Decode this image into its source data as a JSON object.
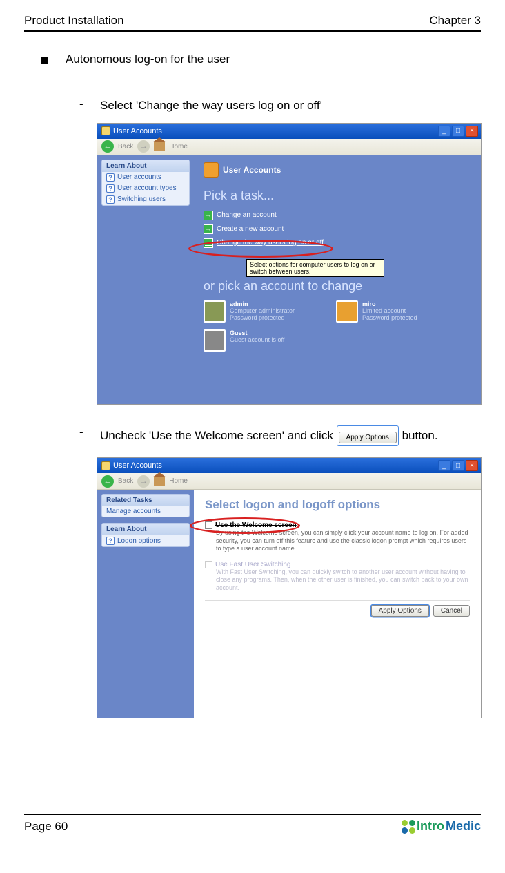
{
  "header": {
    "left": "Product Installation",
    "right": "Chapter 3"
  },
  "bullet1": "Autonomous log-on for the user",
  "step1": "Select 'Change the way users log on or off'",
  "step2_a": "Uncheck 'Use the Welcome screen' and click",
  "step2_b": "button.",
  "apply_btn_inline": "Apply Options",
  "win": {
    "title": "User Accounts",
    "back": "Back",
    "home": "Home",
    "min": "_",
    "max": "□",
    "close": "×"
  },
  "shot1": {
    "learn_head": "Learn About",
    "learn": [
      "User accounts",
      "User account types",
      "Switching users"
    ],
    "ua_title": "User Accounts",
    "pick": "Pick a task...",
    "tasks": [
      "Change an account",
      "Create a new account",
      "Change the way users log on or off"
    ],
    "tooltip": "Select options for computer users to log on or switch between users.",
    "orpick": "or pick an account to change",
    "accts": [
      {
        "name": "admin",
        "role": "Computer administrator",
        "pw": "Password protected"
      },
      {
        "name": "miro",
        "role": "Limited account",
        "pw": "Password protected"
      },
      {
        "name": "Guest",
        "role": "Guest account is off",
        "pw": ""
      }
    ]
  },
  "shot2": {
    "related_head": "Related Tasks",
    "related": "Manage accounts",
    "learn_head": "Learn About",
    "learn": "Logon options",
    "title": "Select logon and logoff options",
    "opt1_head": "Use the Welcome screen",
    "opt1_desc": "By using the Welcome screen, you can simply click your account name to log on. For added security, you can turn off this feature and use the classic logon prompt which requires users to type a user account name.",
    "opt2_head": "Use Fast User Switching",
    "opt2_desc": "With Fast User Switching, you can quickly switch to another user account without having to close any programs. Then, when the other user is finished, you can switch back to your own account.",
    "apply": "Apply Options",
    "cancel": "Cancel"
  },
  "footer": {
    "page": "Page 60",
    "brand_a": "Intro",
    "brand_b": "Medic"
  }
}
